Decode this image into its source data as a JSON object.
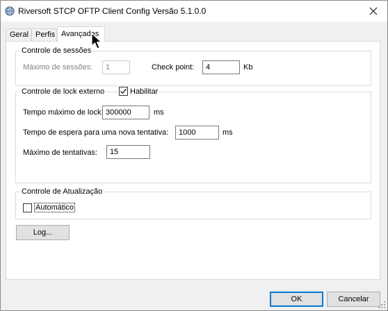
{
  "window": {
    "title": "Riversoft  STCP OFTP Client Config Versão 5.1.0.0"
  },
  "tabs": [
    {
      "label": "Geral"
    },
    {
      "label": "Perfis"
    },
    {
      "label": "Avançadas"
    }
  ],
  "sessions": {
    "legend": "Controle de sessões",
    "max_label": "Máximo de sessões:",
    "max_value": "1",
    "checkpoint_label": "Check point:",
    "checkpoint_value": "4",
    "checkpoint_unit": "Kb"
  },
  "lock": {
    "legend": "Controle de lock externo",
    "enable_label": "Habilitar",
    "enabled": true,
    "max_time_label": "Tempo máximo de lock:",
    "max_time_value": "300000",
    "max_time_unit": "ms",
    "retry_wait_label": "Tempo de espera para uma nova tentativa:",
    "retry_wait_value": "1000",
    "retry_wait_unit": "ms",
    "max_attempts_label": "Máximo de tentativas:",
    "max_attempts_value": "15"
  },
  "update": {
    "legend": "Controle de Atualização",
    "auto_label": "Automático",
    "auto_checked": false
  },
  "buttons": {
    "log": "Log...",
    "ok": "OK",
    "cancel": "Cancelar"
  },
  "colors": {
    "accent": "#0078d7",
    "dialog_bg": "#f0f0f0",
    "disabled_text": "#838383"
  }
}
